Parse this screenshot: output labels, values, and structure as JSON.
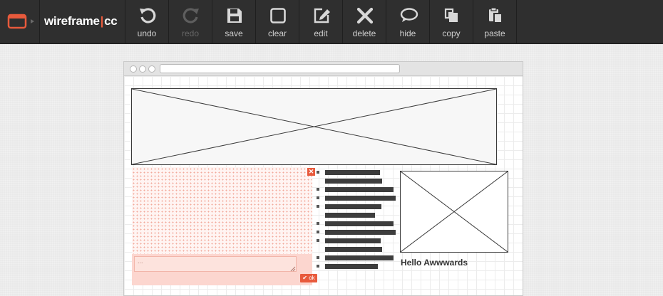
{
  "app": {
    "brand_left": "wireframe",
    "brand_sep": "|",
    "brand_right": "cc"
  },
  "toolbar": {
    "items": [
      {
        "label": "undo",
        "icon": "undo-icon",
        "enabled": true
      },
      {
        "label": "redo",
        "icon": "redo-icon",
        "enabled": false
      },
      {
        "label": "save",
        "icon": "save-icon",
        "enabled": true
      },
      {
        "label": "clear",
        "icon": "clear-icon",
        "enabled": true
      },
      {
        "label": "edit",
        "icon": "edit-icon",
        "enabled": true
      },
      {
        "label": "delete",
        "icon": "delete-icon",
        "enabled": true
      },
      {
        "label": "hide",
        "icon": "hide-icon",
        "enabled": true
      },
      {
        "label": "copy",
        "icon": "copy-icon",
        "enabled": true
      },
      {
        "label": "paste",
        "icon": "paste-icon",
        "enabled": true
      }
    ]
  },
  "canvas": {
    "editor_value": "...",
    "ok_label": "ok",
    "close_symbol": "✕",
    "image_caption": "Hello Awwwards"
  },
  "colors": {
    "accent": "#e85a3c",
    "toolbar_bg": "#2f2f2f",
    "toolbar_label": "#cfcfcf"
  }
}
